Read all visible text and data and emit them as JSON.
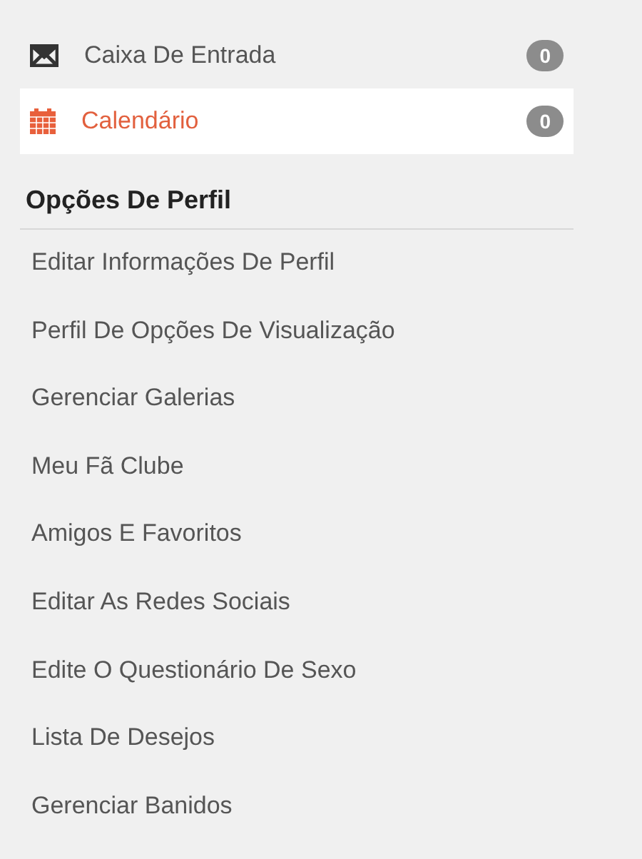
{
  "nav": [
    {
      "kind": "inbox",
      "label": "Caixa De Entrada",
      "count": "0",
      "selected": false
    },
    {
      "kind": "calendar",
      "label": "Calendário",
      "count": "0",
      "selected": true
    }
  ],
  "profile_options": {
    "title": "Opções De Perfil",
    "items": [
      "Editar Informações De Perfil",
      "Perfil De Opções De Visualização",
      "Gerenciar Galerias",
      "Meu Fã Clube",
      "Amigos E Favoritos",
      "Editar As Redes Sociais",
      "Edite O Questionário De Sexo",
      "Lista De Desejos",
      "Gerenciar Banidos"
    ]
  }
}
